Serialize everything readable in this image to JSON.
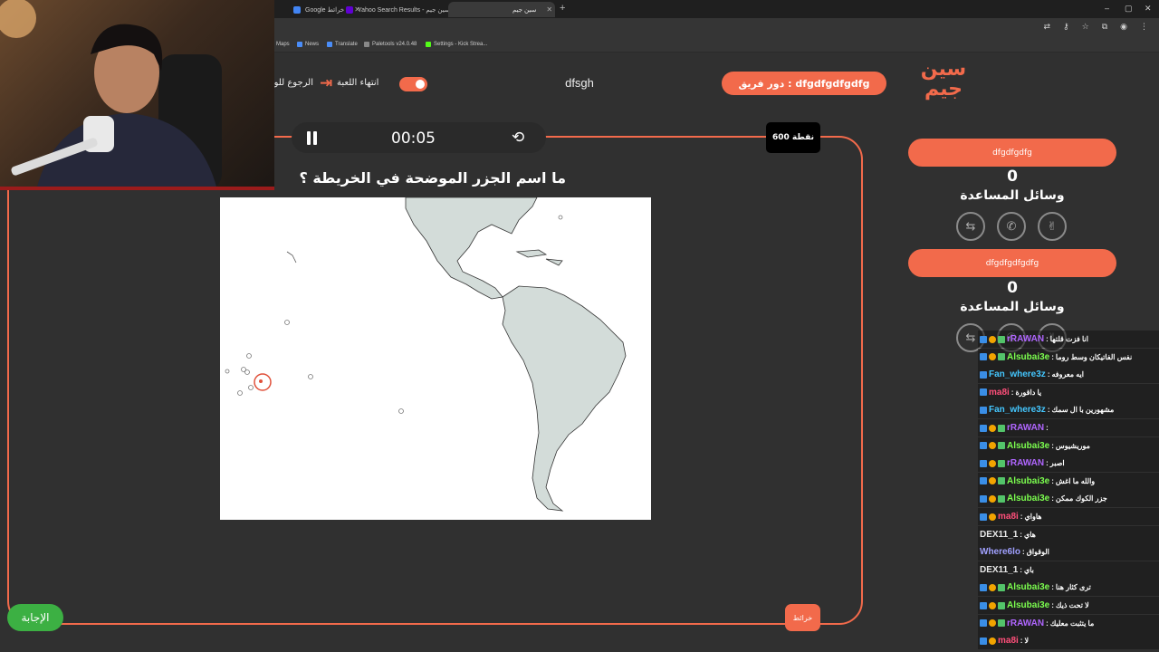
{
  "browser": {
    "tabs": [
      {
        "label": "Google خرائط",
        "active": false
      },
      {
        "label": "Yahoo Search Results - سين جيم",
        "active": false
      },
      {
        "label": "سين جيم",
        "active": true
      }
    ],
    "new_tab": "+",
    "win_min": "–",
    "win_max": "▢",
    "win_close": "✕",
    "bookmarks": [
      "Maps",
      "News",
      "Translate",
      "Paletools v24.0.48",
      "Settings - Kick Strea..."
    ]
  },
  "game": {
    "logo_line1": "سين",
    "logo_line2": "جيم",
    "turn_label": "دور فريق : dfgdfgdfgdfg",
    "game_name": "dfsgh",
    "end_game_label": "انتهاء اللعبة",
    "back_label": "الرجوع للوحة",
    "timer": "00:05",
    "points": "600 نقطة",
    "question": "ما اسم الجزر الموضحة في الخريطة ؟",
    "hint_label": "خرائط",
    "answer_label": "الإجابة",
    "teams": [
      {
        "name": "dfgdfgdfg",
        "score": "0",
        "helps_label": "وسائل المساعدة"
      },
      {
        "name": "dfgdfgdfgdfg",
        "score": "0",
        "helps_label": "وسائل المساعدة"
      }
    ]
  },
  "chat": [
    {
      "user": "rRAWAN",
      "color": "#b066ff",
      "text": "انا فزت قلتها"
    },
    {
      "user": "Alsubai3e",
      "color": "#7cff4f",
      "text": "نفس الفاتيكان وسط روما"
    },
    {
      "user": "Fan_where3z",
      "color": "#44c7ff",
      "text": "ايه معروفه"
    },
    {
      "user": "ma8i",
      "color": "#ff4f7a",
      "text": "يا داقورة"
    },
    {
      "user": "Fan_where3z",
      "color": "#44c7ff",
      "text": "مشهورين با ال سمك"
    },
    {
      "user": "rRAWAN",
      "color": "#b066ff",
      "text": ""
    },
    {
      "user": "Alsubai3e",
      "color": "#7cff4f",
      "text": "موريشيوس"
    },
    {
      "user": "rRAWAN",
      "color": "#b066ff",
      "text": "اصبر"
    },
    {
      "user": "Alsubai3e",
      "color": "#7cff4f",
      "text": "والله ما اغش"
    },
    {
      "user": "Alsubai3e",
      "color": "#7cff4f",
      "text": "جزر الكوك ممكن"
    },
    {
      "user": "ma8i",
      "color": "#ff4f7a",
      "text": "هاواي"
    },
    {
      "user": "DEX11_1",
      "color": "#e8e8e8",
      "text": "هاي"
    },
    {
      "user": "Where6lo",
      "color": "#a0a0ff",
      "text": "الوقواق"
    },
    {
      "user": "DEX11_1",
      "color": "#e8e8e8",
      "text": "باي"
    },
    {
      "user": "Alsubai3e",
      "color": "#7cff4f",
      "text": "ترى كثار هنا"
    },
    {
      "user": "Alsubai3e",
      "color": "#7cff4f",
      "text": "لا تحت ذيك"
    },
    {
      "user": "rRAWAN",
      "color": "#b066ff",
      "text": "ما يتثبت معليك"
    },
    {
      "user": "ma8i",
      "color": "#ff4f7a",
      "text": "لا"
    }
  ],
  "colors": {
    "accent": "#f26a4b",
    "answer": "#3cb043",
    "background": "#303030"
  }
}
